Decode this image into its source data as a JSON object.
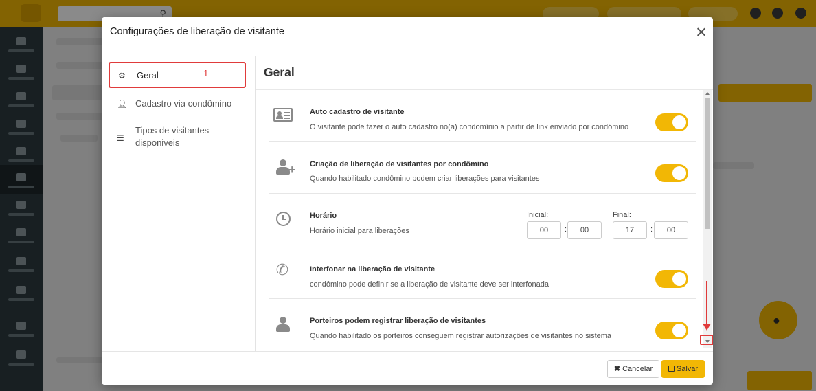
{
  "modal": {
    "title": "Configurações de liberação de visitante"
  },
  "nav": {
    "items": [
      {
        "label": "Geral",
        "annotation": "1"
      },
      {
        "label": "Cadastro via condômino"
      },
      {
        "label": "Tipos de visitantes disponiveis"
      }
    ]
  },
  "panel": {
    "title": "Geral",
    "settings": [
      {
        "title": "Auto cadastro de visitante",
        "description": "O visitante pode fazer o auto cadastro no(a) condomínio a partir de link enviado por condômino",
        "icon": "id-card-icon",
        "enabled": true
      },
      {
        "title": "Criação de liberação de visitantes por condômino",
        "description": "Quando habilitado condômino podem criar liberações para visitantes",
        "icon": "user-plus-icon",
        "enabled": true
      },
      {
        "title": "Horário",
        "description": "Horário inicial para liberações",
        "icon": "clock-icon"
      },
      {
        "title": "Interfonar na liberação de visitante",
        "description": "condômino pode definir se a liberação de visitante deve ser interfonada",
        "icon": "phone-icon",
        "enabled": true
      },
      {
        "title": "Porteiros podem registrar liberação de visitantes",
        "description": "Quando habilitado os porteiros conseguem registrar autorizações de visitantes no sistema",
        "icon": "user-icon",
        "enabled": true
      }
    ],
    "schedule": {
      "start_label": "Inicial:",
      "start_hour": "00",
      "start_minute": "00",
      "end_label": "Final:",
      "end_hour": "17",
      "end_minute": "00",
      "separator": ":"
    }
  },
  "footer": {
    "cancel_label": "Cancelar",
    "save_label": "Salvar"
  },
  "colors": {
    "accent": "#f2b705",
    "annotation_red": "#e03b3b"
  }
}
